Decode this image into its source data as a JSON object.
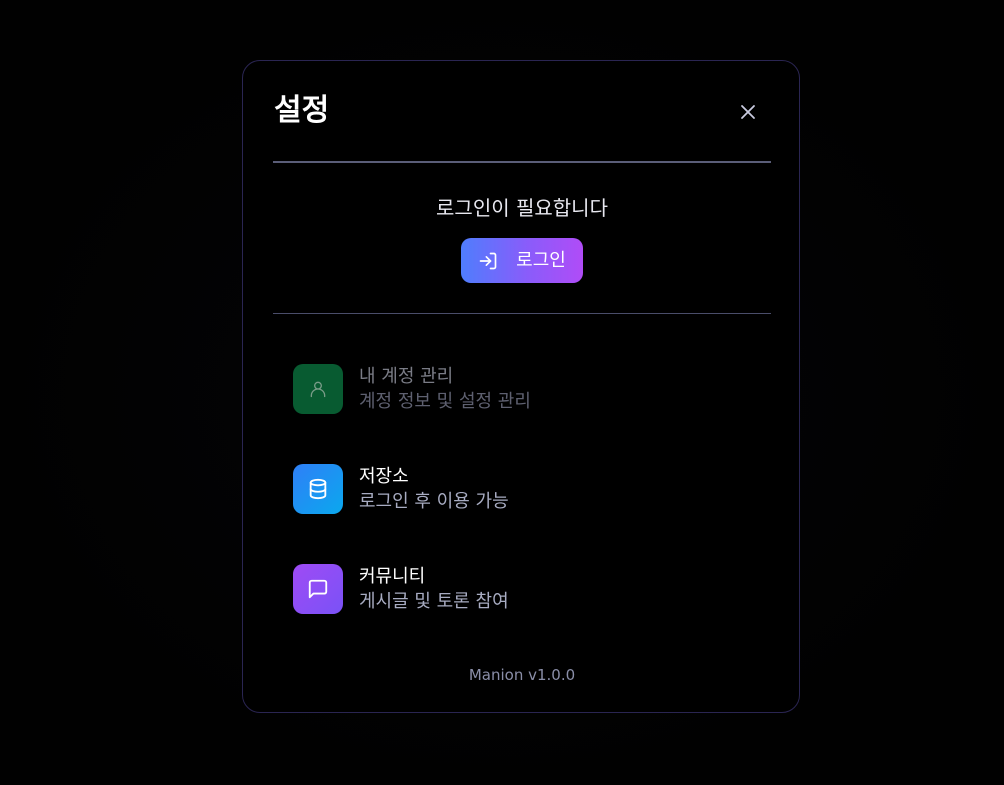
{
  "modal": {
    "title": "설정",
    "close_icon": "close-icon"
  },
  "login": {
    "message": "로그인이 필요합니다",
    "button_label": "로그인",
    "button_icon": "login-icon",
    "gradient": [
      "#4f7dfd",
      "#b04cf7"
    ]
  },
  "menu": {
    "items": [
      {
        "title": "내 계정 관리",
        "subtitle": "계정 정보 및 설정 관리",
        "icon": "user-icon",
        "color": "#0a6b3a",
        "disabled": true
      },
      {
        "title": "저장소",
        "subtitle": "로그인 후 이용 가능",
        "icon": "database-icon",
        "color": "#1a8ff3",
        "disabled": false
      },
      {
        "title": "커뮤니티",
        "subtitle": "게시글 및 토론 참여",
        "icon": "message-square-icon",
        "color": "#8a4ef5",
        "disabled": false
      }
    ]
  },
  "footer": {
    "version": "Manion v1.0.0"
  },
  "colors": {
    "background": "#010101",
    "modal_border": "#2a2552",
    "divider": "#4a4d6a"
  }
}
